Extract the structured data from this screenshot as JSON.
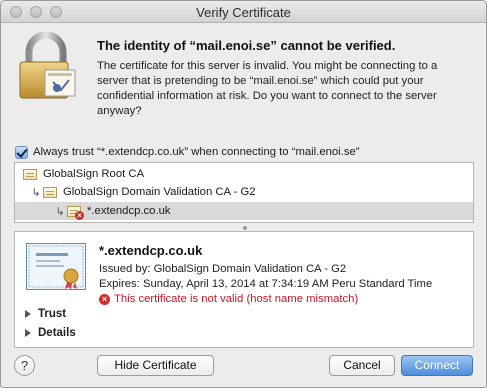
{
  "window": {
    "title": "Verify Certificate"
  },
  "header": {
    "headline": "The identity of “mail.enoi.se” cannot be verified.",
    "description": "The certificate for this server is invalid. You might be connecting to a server that is pretending to be “mail.enoi.se” which could put your confidential information at risk. Do you want to connect to the server anyway?"
  },
  "always_trust": {
    "checked": true,
    "label": "Always trust “*.extendcp.co.uk” when connecting to “mail.enoi.se”"
  },
  "chain": [
    {
      "label": "GlobalSign Root CA"
    },
    {
      "label": "GlobalSign Domain Validation CA - G2"
    },
    {
      "label": "*.extendcp.co.uk"
    }
  ],
  "details": {
    "common_name": "*.extendcp.co.uk",
    "issued_by": "Issued by: GlobalSign Domain Validation CA - G2",
    "expires": "Expires: Sunday, April 13, 2014 at 7:34:19 AM Peru Standard Time",
    "error": "This certificate is not valid (host name mismatch)",
    "sections": [
      {
        "label": "Trust"
      },
      {
        "label": "Details"
      }
    ]
  },
  "buttons": {
    "help": "?",
    "hide_certificate": "Hide Certificate",
    "cancel": "Cancel",
    "connect": "Connect"
  },
  "colors": {
    "error": "#c8161e",
    "default_button": "#4d8ddc",
    "selected_row": "#d9d9d9"
  }
}
